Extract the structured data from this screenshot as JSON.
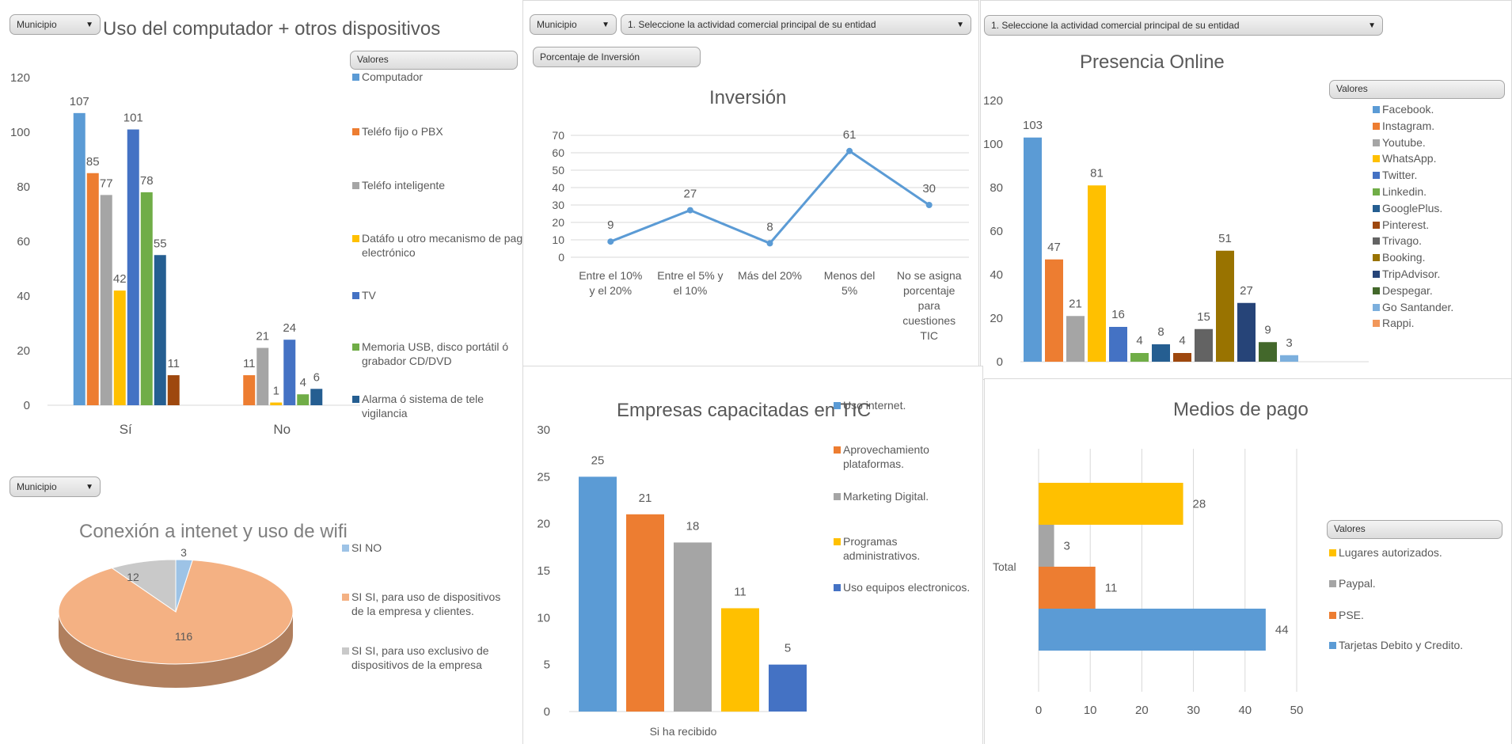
{
  "slicers": {
    "municipio": "Municipio",
    "actividad": "1. Seleccione la actividad comercial principal de su entidad",
    "porcentaje": "Porcentaje de Inversión",
    "valores": "Valores"
  },
  "charts": {
    "dispositivos": {
      "type": "bar",
      "title": "Uso del computador + otros dispositivos",
      "categories": [
        "Sí",
        "No"
      ],
      "series": [
        {
          "name": "Computador",
          "color": "#5b9bd5",
          "values": [
            107,
            null
          ]
        },
        {
          "name": "Teléfo fijo o PBX",
          "color": "#ed7d31",
          "values": [
            85,
            11
          ]
        },
        {
          "name": "Teléfo inteligente",
          "color": "#a5a5a5",
          "values": [
            77,
            21
          ]
        },
        {
          "name": "Datáfo u otro mecanismo de pago electrónico",
          "color": "#ffc000",
          "values": [
            42,
            1
          ]
        },
        {
          "name": "TV",
          "color": "#4472c4",
          "values": [
            101,
            24
          ]
        },
        {
          "name": "Memoria USB, disco portátil ó grabador CD/DVD",
          "color": "#70ad47",
          "values": [
            78,
            4
          ]
        },
        {
          "name": "Alarma ó sistema de tele vigilancia",
          "color": "#255e91",
          "values": [
            55,
            6
          ]
        },
        {
          "name": "",
          "color": "#9e480e",
          "values": [
            11,
            null
          ]
        }
      ],
      "ylim": [
        0,
        120
      ],
      "yticks": [
        0,
        20,
        40,
        60,
        80,
        100,
        120
      ]
    },
    "inversion": {
      "type": "line",
      "title": "Inversión",
      "categories": [
        "Entre el 10% y el 20%",
        "Entre el 5% y el 10%",
        "Más del 20%",
        "Menos del 5%",
        "No se asigna porcentaje para cuestiones TIC"
      ],
      "values": [
        9,
        27,
        8,
        61,
        30
      ],
      "color": "#5b9bd5",
      "ylim": [
        0,
        70
      ],
      "yticks": [
        0,
        10,
        20,
        30,
        40,
        50,
        60,
        70
      ]
    },
    "presencia": {
      "type": "bar",
      "title": "Presencia Online",
      "series": [
        {
          "name": "Facebook.",
          "color": "#5b9bd5",
          "value": 103
        },
        {
          "name": "Instagram.",
          "color": "#ed7d31",
          "value": 47
        },
        {
          "name": "Youtube.",
          "color": "#a5a5a5",
          "value": 21
        },
        {
          "name": "WhatsApp.",
          "color": "#ffc000",
          "value": 81
        },
        {
          "name": "Twitter.",
          "color": "#4472c4",
          "value": 16
        },
        {
          "name": "Linkedin.",
          "color": "#70ad47",
          "value": 4
        },
        {
          "name": "GooglePlus.",
          "color": "#255e91",
          "value": 8
        },
        {
          "name": "Pinterest.",
          "color": "#9e480e",
          "value": 4
        },
        {
          "name": "Trivago.",
          "color": "#636363",
          "value": 15
        },
        {
          "name": "Booking.",
          "color": "#997300",
          "value": 51
        },
        {
          "name": "TripAdvisor.",
          "color": "#264478",
          "value": 27
        },
        {
          "name": "Despegar.",
          "color": "#43682b",
          "value": 9
        },
        {
          "name": "Go Santander.",
          "color": "#7cafdd",
          "value": 3
        },
        {
          "name": "Rappi.",
          "color": "#f1975a",
          "value": null
        }
      ],
      "ylim": [
        0,
        120
      ],
      "yticks": [
        0,
        20,
        40,
        60,
        80,
        100,
        120
      ]
    },
    "wifi": {
      "type": "pie",
      "title": "Conexión a intenet y uso de wifi",
      "slices": [
        {
          "name": "SI NO",
          "color": "#9dc3e6",
          "value": 3
        },
        {
          "name": "SI SI, para uso de dispositivos de la empresa y clientes.",
          "color": "#f4b183",
          "value": 116
        },
        {
          "name": "SI SI, para uso exclusivo de dispositivos de la empresa",
          "color": "#c9c9c9",
          "value": 12
        }
      ]
    },
    "capacitadas": {
      "type": "bar",
      "title": "Empresas capacitadas en TIC",
      "category": "Si ha recibido",
      "series": [
        {
          "name": "Uso internet.",
          "color": "#5b9bd5",
          "value": 25
        },
        {
          "name": "Aprovechamiento plataformas.",
          "color": "#ed7d31",
          "value": 21
        },
        {
          "name": "Marketing Digital.",
          "color": "#a5a5a5",
          "value": 18
        },
        {
          "name": "Programas administrativos.",
          "color": "#ffc000",
          "value": 11
        },
        {
          "name": "Uso equipos electronicos.",
          "color": "#4472c4",
          "value": 5
        }
      ],
      "ylim": [
        0,
        30
      ],
      "yticks": [
        0,
        5,
        10,
        15,
        20,
        25,
        30
      ]
    },
    "medios": {
      "type": "bar",
      "title": "Medios de pago",
      "category": "Total",
      "series": [
        {
          "name": "Lugares autorizados.",
          "color": "#ffc000",
          "value": 28
        },
        {
          "name": "Paypal.",
          "color": "#a5a5a5",
          "value": 3
        },
        {
          "name": "PSE.",
          "color": "#ed7d31",
          "value": 11
        },
        {
          "name": "Tarjetas Debito y Credito.",
          "color": "#5b9bd5",
          "value": 44
        }
      ],
      "xlim": [
        0,
        50
      ],
      "xticks": [
        0,
        10,
        20,
        30,
        40,
        50
      ]
    }
  }
}
